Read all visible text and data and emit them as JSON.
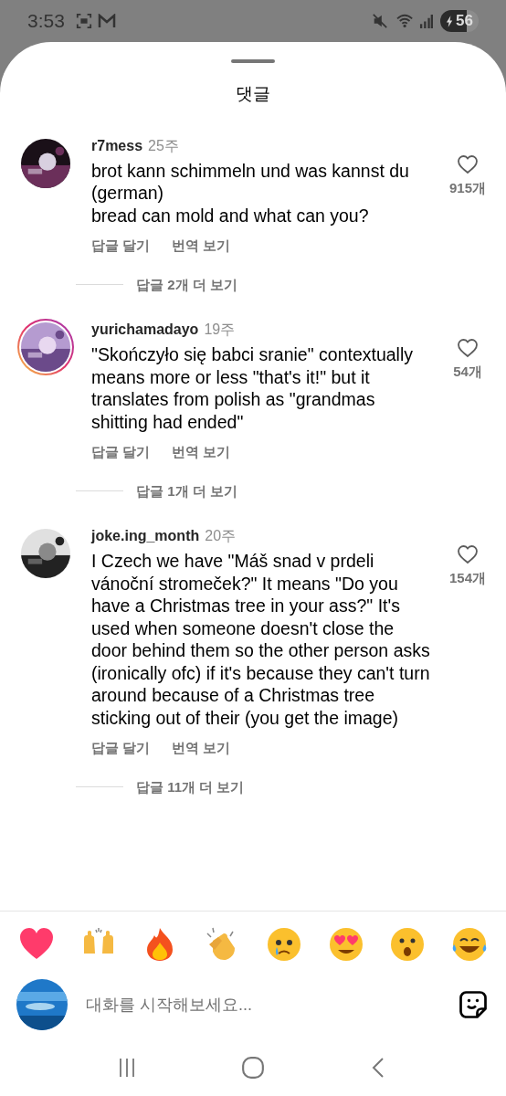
{
  "status_bar": {
    "time": "3:53",
    "battery": "56"
  },
  "sheet": {
    "title": "댓글"
  },
  "comments": [
    {
      "username": "r7mess",
      "age": "25주",
      "text": "brot kann schimmeln und was kannst du (german)\nbread can mold and what can you?",
      "likes": "915개",
      "story_ring": false,
      "actions": [
        "답글 달기",
        "번역 보기"
      ],
      "more_replies": "답글 2개 더 보기"
    },
    {
      "username": "yurichamadayo",
      "age": "19주",
      "text": "\"Skończyło się babci sranie\" contextually means more or less \"that's it!\" but it translates from polish as \"grandmas shitting had ended\"",
      "likes": "54개",
      "story_ring": true,
      "actions": [
        "답글 달기",
        "번역 보기"
      ],
      "more_replies": "답글 1개 더 보기"
    },
    {
      "username": "joke.ing_month",
      "age": "20주",
      "text": "I Czech we have \"Máš snad v prdeli vánoční stromeček?\" It means \"Do you have a Christmas tree in your ass?\" It's used when someone doesn't close the door behind them so the other person asks (ironically ofc) if it's because they can't turn around because of a Christmas tree sticking out of their (you get the image)",
      "likes": "154개",
      "story_ring": false,
      "actions": [
        "답글 달기",
        "번역 보기"
      ],
      "more_replies": "답글 11개 더 보기"
    }
  ],
  "reactions": [
    {
      "kind": "heart"
    },
    {
      "kind": "raised_hands"
    },
    {
      "kind": "fire"
    },
    {
      "kind": "clap"
    },
    {
      "kind": "sad"
    },
    {
      "kind": "heart_eyes"
    },
    {
      "kind": "surprised"
    },
    {
      "kind": "laugh_tears"
    }
  ],
  "composer": {
    "placeholder": "대화를 시작해보세요..."
  }
}
